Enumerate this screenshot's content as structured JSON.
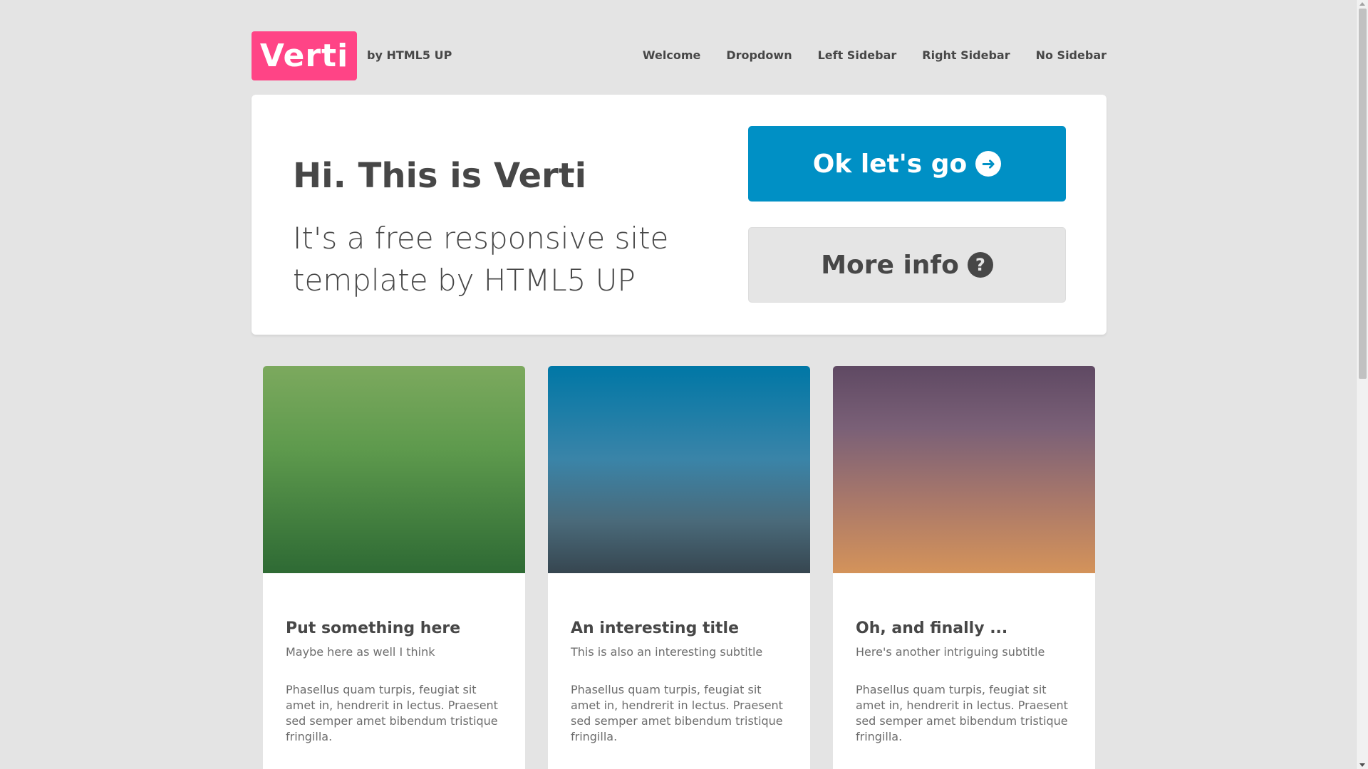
{
  "header": {
    "logo": "Verti",
    "byline": "by HTML5 UP",
    "nav": [
      "Welcome",
      "Dropdown",
      "Left Sidebar",
      "Right Sidebar",
      "No Sidebar"
    ]
  },
  "banner": {
    "title": "Hi. This is Verti",
    "subtitle": "It's a free responsive site template by HTML5 UP",
    "primary_button": "Ok let's go",
    "secondary_button": "More info"
  },
  "cards": [
    {
      "title": "Put something here",
      "subtitle": "Maybe here as well I think",
      "body": "Phasellus quam turpis, feugiat sit amet in, hendrerit in lectus. Praesent sed semper amet bibendum tristique fringilla."
    },
    {
      "title": "An interesting title",
      "subtitle": "This is also an interesting subtitle",
      "body": "Phasellus quam turpis, feugiat sit amet in, hendrerit in lectus. Praesent sed semper amet bibendum tristique fringilla."
    },
    {
      "title": "Oh, and finally ...",
      "subtitle": "Here's another intriguing subtitle",
      "body": "Phasellus quam turpis, feugiat sit amet in, hendrerit in lectus. Praesent sed semper amet bibendum tristique fringilla."
    }
  ],
  "colors": {
    "background": "#e4e4e4",
    "logo": "#ff4486",
    "primary": "#0090c5",
    "text": "#474747"
  },
  "icons": {
    "primary_button_icon": "arrow-right-circle-icon",
    "secondary_button_icon": "question-circle-icon"
  }
}
